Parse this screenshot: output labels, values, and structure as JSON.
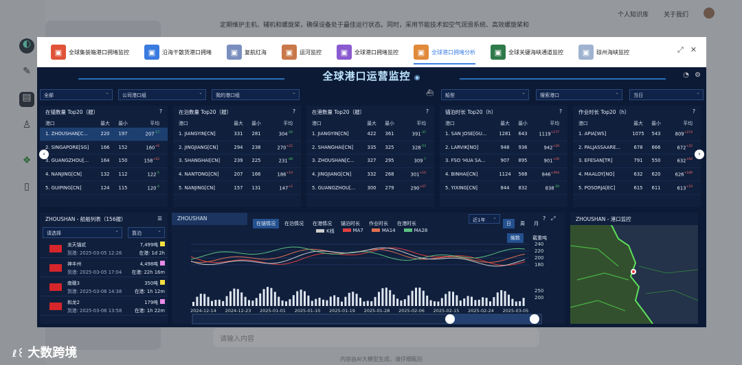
{
  "background": {
    "text_line1": "定期维护主机、辅机和螺旋桨，确保设备处于最佳运行状态。同时，采用节能技术如空气润滑系统、高效螺旋桨和",
    "top_right": [
      "个人知识库",
      "关于我们"
    ],
    "input_placeholder": "请输入内容",
    "footer": "内容由AI大模型生成，请仔细甄别",
    "logo": "大数跨境"
  },
  "tabs": [
    {
      "label": "全球集装箱港口拥堵监控",
      "color": "#e0533a"
    },
    {
      "label": "沿海干散货港口拥堵",
      "color": "#3a7be0"
    },
    {
      "label": "复航红海",
      "color": "#7a8fbf"
    },
    {
      "label": "运河监控",
      "color": "#c9784a"
    },
    {
      "label": "全球港口拥堵监控",
      "color": "#8a5ad0"
    },
    {
      "label": "全球港口拥堵分析",
      "color": "#e08a3a",
      "active": true
    },
    {
      "label": "全球关键海峡通道监控",
      "color": "#2f7a4a"
    },
    {
      "label": "琼州海峡监控",
      "color": "#9fb3cf"
    }
  ],
  "dashboard": {
    "title": "全球港口运营监控",
    "filters": [
      "全部",
      "公司港口组",
      "我的港口组",
      "船型",
      "搜索港口",
      "当日"
    ],
    "panels": [
      {
        "title": "在锚数量 Top20（艘）",
        "headers": [
          "港口",
          "最大",
          "最小",
          "平均"
        ],
        "rows": [
          [
            "1. ZHOUSHAN[C...",
            "220",
            "197",
            "207",
            "-17",
            "dn"
          ],
          [
            "2. SINGAPORE[SG]",
            "166",
            "152",
            "160",
            "+6",
            "up"
          ],
          [
            "3. GUANGZHOU[...",
            "164",
            "150",
            "158",
            "+22",
            "up"
          ],
          [
            "4. NANJING[CN]",
            "132",
            "112",
            "122",
            "-5",
            "dn"
          ],
          [
            "5. GUIPING[CN]",
            "124",
            "115",
            "120",
            "-4",
            "dn"
          ]
        ]
      },
      {
        "title": "在泊数量 Top20（艘）",
        "headers": [
          "港口",
          "最大",
          "最小",
          "平均"
        ],
        "rows": [
          [
            "1. JIANGYIN[CN]",
            "331",
            "281",
            "304",
            "-29",
            "dn"
          ],
          [
            "2. JINGJIANG[CN]",
            "294",
            "238",
            "270",
            "+22",
            "up"
          ],
          [
            "3. SHANGHAI[CN]",
            "239",
            "225",
            "231",
            "-48",
            "dn"
          ],
          [
            "4. NANTONG[CN]",
            "207",
            "166",
            "186",
            "+10",
            "up"
          ],
          [
            "5. NANJING[CN]",
            "157",
            "131",
            "147",
            "+2",
            "up"
          ]
        ]
      },
      {
        "title": "在港数量 Top20（艘）",
        "headers": [
          "港口",
          "最大",
          "最小",
          "平均"
        ],
        "rows": [
          [
            "1. JIANGYIN[CN]",
            "422",
            "361",
            "391",
            "-37",
            "dn"
          ],
          [
            "2. SHANGHAI[CN]",
            "335",
            "325",
            "328",
            "-53",
            "dn"
          ],
          [
            "3. ZHOUSHAN[C...",
            "327",
            "295",
            "309",
            "-7",
            "dn"
          ],
          [
            "4. JINGJIANG[CN]",
            "332",
            "268",
            "301",
            "+10",
            "up"
          ],
          [
            "5. GUANGZHOU[...",
            "300",
            "279",
            "290",
            "+27",
            "up"
          ]
        ]
      },
      {
        "title": "锚泊时长 Top20（h）",
        "headers": [
          "港口",
          "最大",
          "最小",
          "平均"
        ],
        "rows": [
          [
            "1. SAN JOSE[GU...",
            "1281",
            "643",
            "1119",
            "+177",
            "up"
          ],
          [
            "2. LARVIK[NO]",
            "948",
            "936",
            "942",
            "+20",
            "up"
          ],
          [
            "3. FSO 'HUA SA...",
            "907",
            "895",
            "901",
            "+20",
            "up"
          ],
          [
            "4. BINHAI[CN]",
            "1124",
            "568",
            "846",
            "+264",
            "up"
          ],
          [
            "5. YIXING[CN]",
            "844",
            "832",
            "838",
            "-20",
            "dn"
          ]
        ]
      },
      {
        "title": "作业时长 Top20（h）",
        "headers": [
          "港口",
          "最大",
          "最小",
          "平均"
        ],
        "rows": [
          [
            "1. APIA[WS]",
            "1075",
            "543",
            "809",
            "+274",
            "up"
          ],
          [
            "2. PALJASSAARE...",
            "678",
            "666",
            "672",
            "+22",
            "up"
          ],
          [
            "3. EFESAN[TR]",
            "791",
            "550",
            "632",
            "+64",
            "up"
          ],
          [
            "4. MAALOY[NO]",
            "632",
            "620",
            "626",
            "+189",
            "up"
          ],
          [
            "5. POSORJA[EC]",
            "615",
            "611",
            "613",
            "+19",
            "up"
          ]
        ]
      }
    ],
    "shiplist": {
      "title": "ZHOUSHAN - 船舶列表（156艘）",
      "filter1": "请选择",
      "filter2": "靠泊",
      "ships": [
        {
          "name": "龙天锚贰",
          "dwt": "7,499吨",
          "arrive": "到港: 2025-03-05 12:26",
          "stay": "在港: 1d 2h"
        },
        {
          "name": "神丰州",
          "dwt": "4,498吨",
          "arrive": "到港: 2025-03-05 17:04",
          "stay": "在港: 22h 16m"
        },
        {
          "name": "南赣3",
          "dwt": "350吨",
          "arrive": "到港: 2025-03-06 14:38",
          "stay": "在港: 1h 12m"
        },
        {
          "name": "和龙2",
          "dwt": "179吨",
          "arrive": "到港: 2025-03-06 13:58",
          "stay": "在港: 1h 22m"
        }
      ]
    },
    "trend": {
      "port": "ZHOUSHAN",
      "tabs": [
        "在锚情况",
        "在泊情况",
        "在港情况",
        "锚泊时长",
        "作业时长",
        "在港时长"
      ],
      "range": "近1年",
      "periods": [
        "日",
        "周",
        "月"
      ],
      "views": [
        "艘数",
        "载重吨"
      ],
      "legend": [
        "K线",
        "MA7",
        "MA14",
        "MA28"
      ],
      "y_top": [
        "240",
        "220",
        "200",
        "180"
      ],
      "y_bottom": [
        "250",
        "200"
      ],
      "dates": [
        "2024-12-14",
        "2024-12-23",
        "2025-01-01",
        "2025-01-10",
        "2025-01-19",
        "2025-01-28",
        "2025-02-06",
        "2025-02-15",
        "2025-02-24",
        "2025-03-05"
      ]
    },
    "map": {
      "title": "ZHOUSHAN - 港口监控"
    }
  }
}
